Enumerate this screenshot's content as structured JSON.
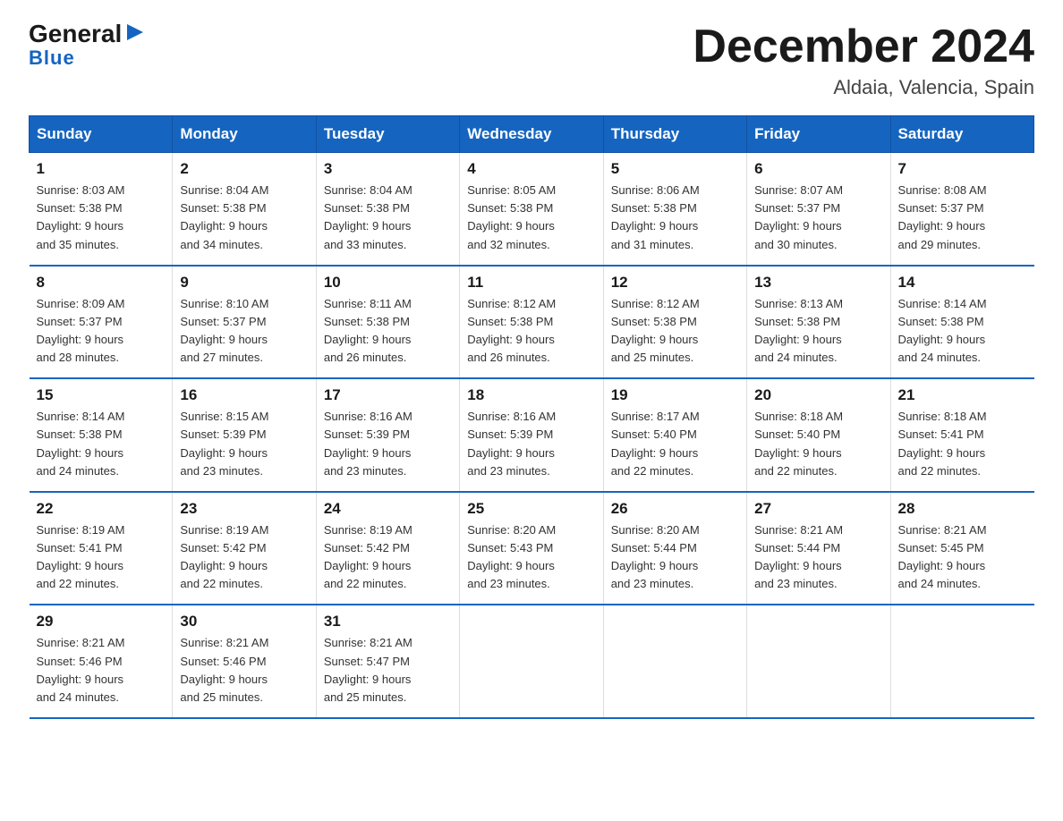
{
  "logo": {
    "text1": "General",
    "arrow": "▶",
    "text2": "Blue"
  },
  "title": "December 2024",
  "subtitle": "Aldaia, Valencia, Spain",
  "days_header": [
    "Sunday",
    "Monday",
    "Tuesday",
    "Wednesday",
    "Thursday",
    "Friday",
    "Saturday"
  ],
  "weeks": [
    [
      {
        "day": "1",
        "sunrise": "8:03 AM",
        "sunset": "5:38 PM",
        "daylight": "9 hours and 35 minutes."
      },
      {
        "day": "2",
        "sunrise": "8:04 AM",
        "sunset": "5:38 PM",
        "daylight": "9 hours and 34 minutes."
      },
      {
        "day": "3",
        "sunrise": "8:04 AM",
        "sunset": "5:38 PM",
        "daylight": "9 hours and 33 minutes."
      },
      {
        "day": "4",
        "sunrise": "8:05 AM",
        "sunset": "5:38 PM",
        "daylight": "9 hours and 32 minutes."
      },
      {
        "day": "5",
        "sunrise": "8:06 AM",
        "sunset": "5:38 PM",
        "daylight": "9 hours and 31 minutes."
      },
      {
        "day": "6",
        "sunrise": "8:07 AM",
        "sunset": "5:37 PM",
        "daylight": "9 hours and 30 minutes."
      },
      {
        "day": "7",
        "sunrise": "8:08 AM",
        "sunset": "5:37 PM",
        "daylight": "9 hours and 29 minutes."
      }
    ],
    [
      {
        "day": "8",
        "sunrise": "8:09 AM",
        "sunset": "5:37 PM",
        "daylight": "9 hours and 28 minutes."
      },
      {
        "day": "9",
        "sunrise": "8:10 AM",
        "sunset": "5:37 PM",
        "daylight": "9 hours and 27 minutes."
      },
      {
        "day": "10",
        "sunrise": "8:11 AM",
        "sunset": "5:38 PM",
        "daylight": "9 hours and 26 minutes."
      },
      {
        "day": "11",
        "sunrise": "8:12 AM",
        "sunset": "5:38 PM",
        "daylight": "9 hours and 26 minutes."
      },
      {
        "day": "12",
        "sunrise": "8:12 AM",
        "sunset": "5:38 PM",
        "daylight": "9 hours and 25 minutes."
      },
      {
        "day": "13",
        "sunrise": "8:13 AM",
        "sunset": "5:38 PM",
        "daylight": "9 hours and 24 minutes."
      },
      {
        "day": "14",
        "sunrise": "8:14 AM",
        "sunset": "5:38 PM",
        "daylight": "9 hours and 24 minutes."
      }
    ],
    [
      {
        "day": "15",
        "sunrise": "8:14 AM",
        "sunset": "5:38 PM",
        "daylight": "9 hours and 24 minutes."
      },
      {
        "day": "16",
        "sunrise": "8:15 AM",
        "sunset": "5:39 PM",
        "daylight": "9 hours and 23 minutes."
      },
      {
        "day": "17",
        "sunrise": "8:16 AM",
        "sunset": "5:39 PM",
        "daylight": "9 hours and 23 minutes."
      },
      {
        "day": "18",
        "sunrise": "8:16 AM",
        "sunset": "5:39 PM",
        "daylight": "9 hours and 23 minutes."
      },
      {
        "day": "19",
        "sunrise": "8:17 AM",
        "sunset": "5:40 PM",
        "daylight": "9 hours and 22 minutes."
      },
      {
        "day": "20",
        "sunrise": "8:18 AM",
        "sunset": "5:40 PM",
        "daylight": "9 hours and 22 minutes."
      },
      {
        "day": "21",
        "sunrise": "8:18 AM",
        "sunset": "5:41 PM",
        "daylight": "9 hours and 22 minutes."
      }
    ],
    [
      {
        "day": "22",
        "sunrise": "8:19 AM",
        "sunset": "5:41 PM",
        "daylight": "9 hours and 22 minutes."
      },
      {
        "day": "23",
        "sunrise": "8:19 AM",
        "sunset": "5:42 PM",
        "daylight": "9 hours and 22 minutes."
      },
      {
        "day": "24",
        "sunrise": "8:19 AM",
        "sunset": "5:42 PM",
        "daylight": "9 hours and 22 minutes."
      },
      {
        "day": "25",
        "sunrise": "8:20 AM",
        "sunset": "5:43 PM",
        "daylight": "9 hours and 23 minutes."
      },
      {
        "day": "26",
        "sunrise": "8:20 AM",
        "sunset": "5:44 PM",
        "daylight": "9 hours and 23 minutes."
      },
      {
        "day": "27",
        "sunrise": "8:21 AM",
        "sunset": "5:44 PM",
        "daylight": "9 hours and 23 minutes."
      },
      {
        "day": "28",
        "sunrise": "8:21 AM",
        "sunset": "5:45 PM",
        "daylight": "9 hours and 24 minutes."
      }
    ],
    [
      {
        "day": "29",
        "sunrise": "8:21 AM",
        "sunset": "5:46 PM",
        "daylight": "9 hours and 24 minutes."
      },
      {
        "day": "30",
        "sunrise": "8:21 AM",
        "sunset": "5:46 PM",
        "daylight": "9 hours and 25 minutes."
      },
      {
        "day": "31",
        "sunrise": "8:21 AM",
        "sunset": "5:47 PM",
        "daylight": "9 hours and 25 minutes."
      },
      null,
      null,
      null,
      null
    ]
  ]
}
